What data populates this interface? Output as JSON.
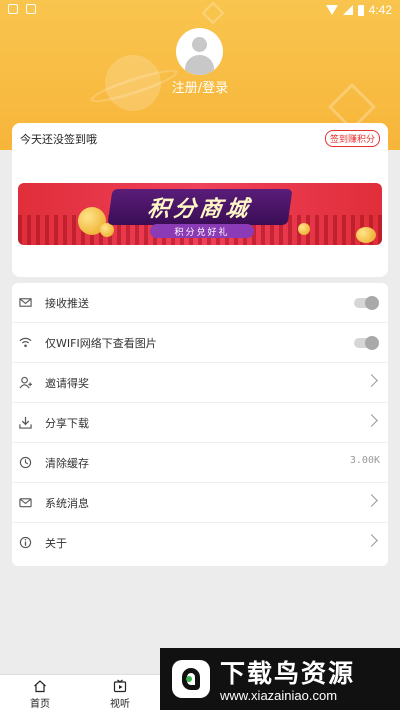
{
  "statusbar": {
    "time": "4:42"
  },
  "profile": {
    "login_text": "注册/登录"
  },
  "signin": {
    "prompt": "今天还没签到哦",
    "button_label": "签到赚积分"
  },
  "banner": {
    "title": "积分商城",
    "subtitle": "积分兑好礼"
  },
  "menu": {
    "items": [
      {
        "label": "接收推送",
        "icon": "mail-icon",
        "control": "toggle",
        "on": false
      },
      {
        "label": "仅WIFI网络下查看图片",
        "icon": "wifi-icon",
        "control": "toggle",
        "on": false
      },
      {
        "label": "邀请得奖",
        "icon": "user-add-icon",
        "control": "chevron"
      },
      {
        "label": "分享下载",
        "icon": "download-icon",
        "control": "chevron"
      },
      {
        "label": "清除缓存",
        "icon": "clock-icon",
        "control": "value",
        "value": "3.00K"
      },
      {
        "label": "系统消息",
        "icon": "envelope-icon",
        "control": "chevron"
      },
      {
        "label": "关于",
        "icon": "info-icon",
        "control": "chevron"
      }
    ]
  },
  "tabbar": {
    "tabs": [
      {
        "label": "首页",
        "icon": "home-icon"
      },
      {
        "label": "视听",
        "icon": "video-icon"
      }
    ]
  },
  "watermark": {
    "title": "下载鸟资源",
    "url": "www.xiazainiao.com"
  },
  "colors": {
    "header": "#f7b53a",
    "accent_red": "#e5312f",
    "background": "#ececec"
  }
}
